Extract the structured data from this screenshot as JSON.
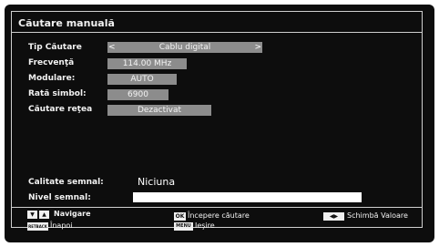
{
  "dialog": {
    "title": "Căutare manuală"
  },
  "fields": {
    "search_type": {
      "label": "Tip Căutare",
      "value": "Cablu digital"
    },
    "frequency": {
      "label": "Frecvenţă",
      "value": "114.00 MHz"
    },
    "modulation": {
      "label": "Modulare:",
      "value": "AUTO"
    },
    "symbol_rate": {
      "label": "Rată simbol:",
      "value": "6900"
    },
    "network_search": {
      "label": "Căutare reţea",
      "value": "Dezactivat"
    }
  },
  "signal": {
    "quality_label": "Calitate semnal:",
    "quality_value": "Niciuna",
    "level_label": "Nivel semnal:"
  },
  "footer": {
    "navigate": "Navigare",
    "back_key": "RETBACK",
    "back": "Înapoi",
    "ok_key": "OK",
    "start_search": "Începere căutare",
    "menu_key": "MENU",
    "exit": "Ieşire",
    "change_value": "Schimbă Valoare"
  },
  "colors": {
    "background": "#0d0d0d",
    "field": "#8c8c8c",
    "text": "#f2f2f2",
    "border": "#cfcfcf"
  }
}
